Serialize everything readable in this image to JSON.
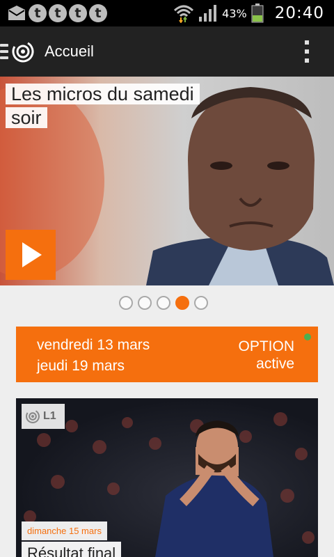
{
  "status_bar": {
    "notification_icons": [
      {
        "icon": "mail-icon"
      },
      {
        "icon": "t-icon",
        "glyph": "t"
      },
      {
        "icon": "t-icon",
        "glyph": "t"
      },
      {
        "icon": "t-icon",
        "glyph": "t"
      },
      {
        "icon": "t-icon",
        "glyph": "t"
      }
    ],
    "battery_percent": "43%",
    "battery_level": 0.43,
    "time": "20:40"
  },
  "action_bar": {
    "title": "Accueil"
  },
  "hero": {
    "title": "Les micros du samedi soir",
    "carousel_total": 5,
    "carousel_active_index": 4
  },
  "option_banner": {
    "date_line_1": "vendredi 13 mars",
    "date_line_2": "jeudi 19 mars",
    "status_line_1": "OPTION",
    "status_line_2": "active",
    "status_dot_color": "#4caf50"
  },
  "match_card": {
    "badge_label": "L1",
    "date": "dimanche 15 mars",
    "result": "Résultat final"
  },
  "colors": {
    "accent": "#f56f0e",
    "toolbar": "#222222",
    "background": "#eeeeee"
  }
}
